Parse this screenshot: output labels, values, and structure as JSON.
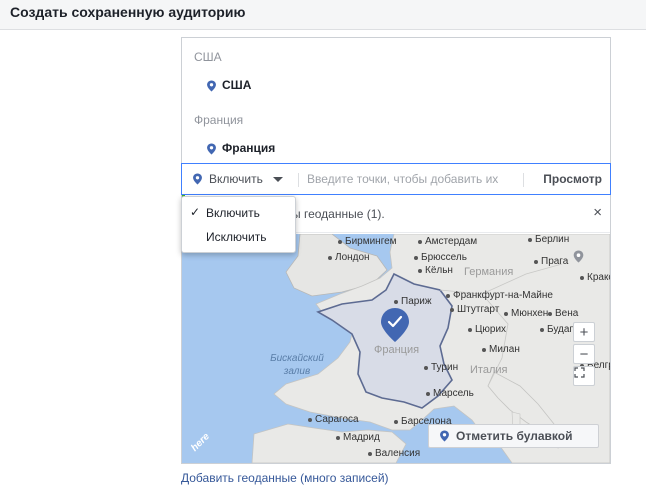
{
  "header": {
    "title": "Создать сохраненную аудиторию"
  },
  "locations": {
    "groups": [
      {
        "label": "США",
        "item": "США"
      },
      {
        "label": "Франция",
        "item": "Франция"
      }
    ]
  },
  "toolbar": {
    "mode_label": "Включить",
    "search_placeholder": "Введите точки, чтобы добавить их",
    "browse_label": "Просмотр"
  },
  "dropdown": {
    "options": [
      "Включить",
      "Исключить"
    ],
    "selected": "Включить"
  },
  "notice": {
    "text": "ы геоданные (1).",
    "close_symbol": "×"
  },
  "map": {
    "cities": [
      "Бирмингем",
      "Амстердам",
      "Берлин",
      "Лондон",
      "Брюссель",
      "Кёльн",
      "Прага",
      "Франкфурт-на-Майне",
      "Кракова",
      "Париж",
      "Штутгарт",
      "Мюнхен",
      "Вена",
      "Цюрих",
      "Будапешт",
      "Турин",
      "Милан",
      "Белграде",
      "Марсель",
      "Сарагоса",
      "Барселона",
      "Мадрид",
      "Валенсия"
    ],
    "countries": [
      "Германия",
      "Франция",
      "Италия"
    ],
    "sea": "Бискайский залив",
    "zoom_in": "+",
    "zoom_out": "−",
    "drop_pin_label": "Отметить булавкой",
    "logo_text": "here",
    "accent_color": "#4267b2"
  },
  "footer": {
    "add_bulk_link": "Добавить геоданные (много записей)"
  }
}
